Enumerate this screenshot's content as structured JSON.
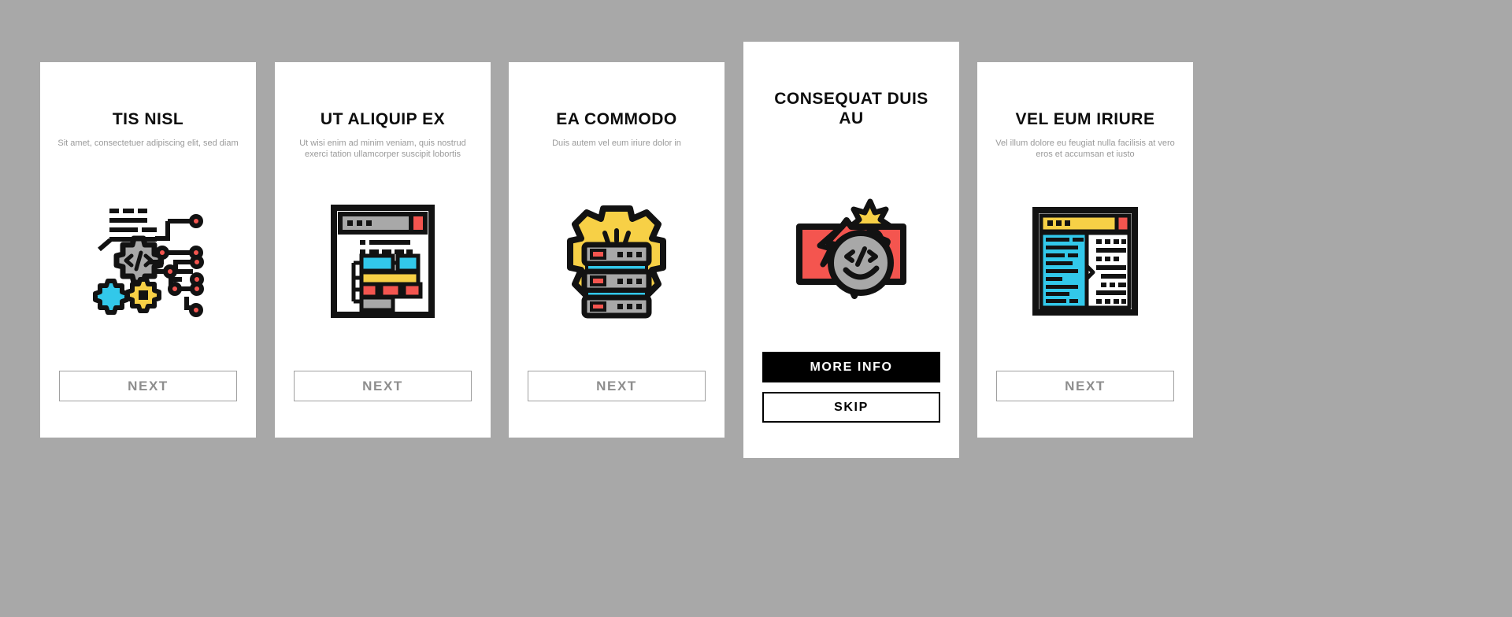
{
  "background_color": "#a8a8a8",
  "cards": [
    {
      "id": "card-1",
      "title": "TIS NISL",
      "subtitle": "Sit amet, consectetuer adipiscing elit, sed diam",
      "icon": "gears-code-circuit-icon",
      "buttons": [
        {
          "label": "NEXT",
          "style": "outline"
        }
      ]
    },
    {
      "id": "card-2",
      "title": "UT ALIQUIP EX",
      "subtitle": "Ut wisi enim ad minim veniam, quis nostrud exerci tation ullamcorper suscipit lobortis",
      "icon": "browser-flowchart-icon",
      "buttons": [
        {
          "label": "NEXT",
          "style": "outline"
        }
      ]
    },
    {
      "id": "card-3",
      "title": "EA COMMODO",
      "subtitle": "Duis autem vel eum iriure dolor in",
      "icon": "server-gear-icon",
      "buttons": [
        {
          "label": "NEXT",
          "style": "outline"
        }
      ]
    },
    {
      "id": "card-4",
      "title": "CONSEQUAT DUIS AU",
      "subtitle": "",
      "icon": "bug-bomb-chat-icon",
      "buttons": [
        {
          "label": "MORE INFO",
          "style": "solid"
        },
        {
          "label": "SKIP",
          "style": "bold-outline"
        }
      ]
    },
    {
      "id": "card-5",
      "title": "VEL EUM IRIURE",
      "subtitle": "Vel illum dolore eu feugiat nulla facilisis at vero eros et accumsan et iusto",
      "icon": "code-editor-window-icon",
      "buttons": [
        {
          "label": "NEXT",
          "style": "outline"
        }
      ]
    }
  ],
  "palette": {
    "yellow": "#f7d046",
    "cyan": "#32c8ea",
    "red": "#f4554f",
    "gray": "#a8a8a8",
    "black": "#121212",
    "white": "#ffffff",
    "muted_text": "#9a9a9a",
    "title_text": "#0d0d0d",
    "button_border": "#a0a0a0",
    "button_text": "#8e8e8e"
  }
}
